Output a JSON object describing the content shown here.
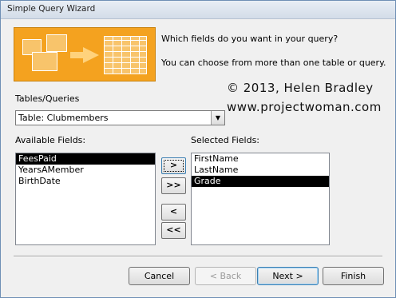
{
  "window": {
    "title": "Simple Query Wizard"
  },
  "header": {
    "question": "Which fields do you want in your query?",
    "hint": "You can choose from more than one table or query."
  },
  "watermark": {
    "line1": "© 2013, Helen Bradley",
    "line2": "www.projectwoman.com"
  },
  "tables": {
    "label": "Tables/Queries",
    "selected": "Table: Clubmembers"
  },
  "available": {
    "label": "Available Fields:",
    "items": [
      "FeesPaid",
      "YearsAMember",
      "BirthDate"
    ],
    "selected_index": 0
  },
  "selected": {
    "label": "Selected Fields:",
    "items": [
      "FirstName",
      "LastName",
      "Grade"
    ],
    "selected_index": 2
  },
  "move_buttons": {
    "add_one": ">",
    "add_all": ">>",
    "remove_one": "<",
    "remove_all": "<<"
  },
  "footer": {
    "cancel": "Cancel",
    "back": "< Back",
    "next": "Next >",
    "finish": "Finish"
  },
  "colors": {
    "illustration": "#f4a21f",
    "selection": "#000000"
  }
}
